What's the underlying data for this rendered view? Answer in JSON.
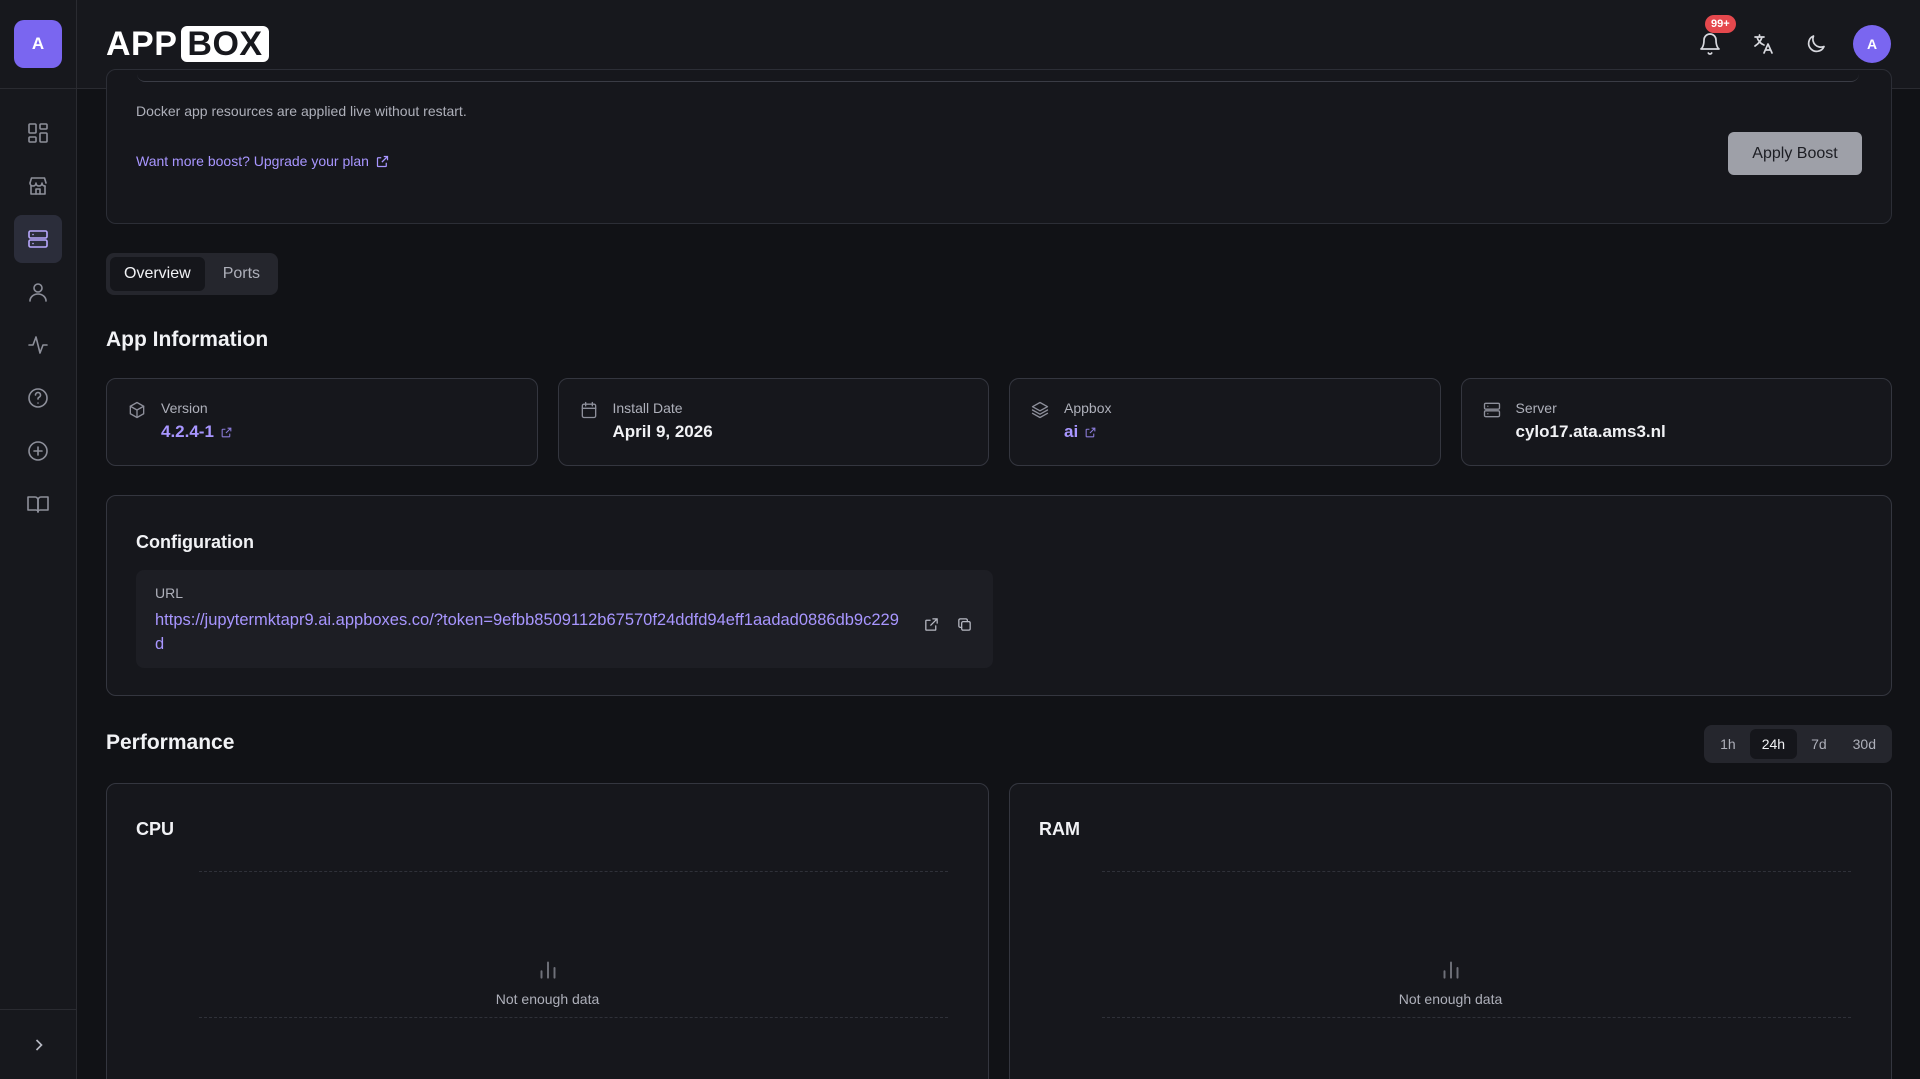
{
  "sidebar": {
    "avatar_letter": "A",
    "nav_icons": [
      "dashboard-icon",
      "store-icon",
      "server-icon",
      "user-icon",
      "activity-icon",
      "help-icon",
      "add-circle-icon",
      "book-icon"
    ],
    "active_index": 2,
    "collapse_icon": "chevron-right-icon"
  },
  "header": {
    "logo_app": "APP",
    "logo_box": "BOX",
    "notification_badge": "99+",
    "user_avatar_letter": "A"
  },
  "boost": {
    "note": "Docker app resources are applied live without restart.",
    "upgrade_link": "Want more boost? Upgrade your plan",
    "apply_button": "Apply Boost"
  },
  "tabs": [
    {
      "label": "Overview",
      "active": true
    },
    {
      "label": "Ports",
      "active": false
    }
  ],
  "app_info": {
    "title": "App Information",
    "cards": [
      {
        "icon": "package-icon",
        "label": "Version",
        "value": "4.2.4-1",
        "is_link": true
      },
      {
        "icon": "calendar-icon",
        "label": "Install Date",
        "value": "April 9, 2026",
        "is_link": false
      },
      {
        "icon": "layers-icon",
        "label": "Appbox",
        "value": "ai",
        "is_link": true
      },
      {
        "icon": "server-icon",
        "label": "Server",
        "value": "cylo17.ata.ams3.nl",
        "is_link": false
      }
    ]
  },
  "configuration": {
    "title": "Configuration",
    "url_label": "URL",
    "url_value": "https://jupytermktapr9.ai.appboxes.co/?token=9efbb8509112b67570f24ddfd94eff1aadad0886db9c229d"
  },
  "performance": {
    "title": "Performance",
    "ranges": [
      {
        "label": "1h",
        "active": false
      },
      {
        "label": "24h",
        "active": true
      },
      {
        "label": "7d",
        "active": false
      },
      {
        "label": "30d",
        "active": false
      }
    ],
    "charts": [
      {
        "title": "CPU",
        "empty_text": "Not enough data"
      },
      {
        "title": "RAM",
        "empty_text": "Not enough data"
      }
    ]
  },
  "colors": {
    "accent": "#7a66f0",
    "link": "#a896ff",
    "background": "#111216",
    "badge": "#e5484d"
  }
}
